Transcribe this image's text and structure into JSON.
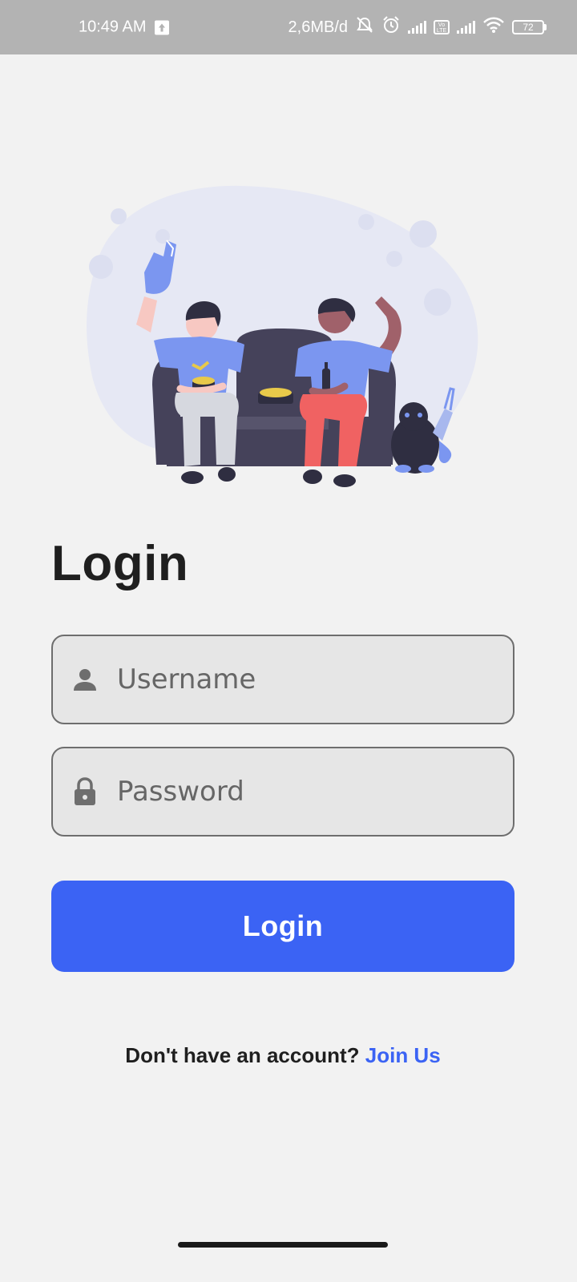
{
  "status_bar": {
    "time": "10:49 AM",
    "data_rate": "2,6MB/d",
    "battery_level": "72",
    "volte_label": "Vo LTE",
    "icons": [
      "upload-icon",
      "mute-icon",
      "alarm-icon",
      "signal-icon",
      "volte-icon",
      "signal-icon",
      "wifi-icon",
      "battery-icon"
    ]
  },
  "illustration": {
    "description_icon": "two-people-on-couch-illustration",
    "colors": {
      "blob": "#e6e8f4",
      "couch": "#45425a",
      "shirt": "#7b96f0",
      "pants_left": "#d6d8df",
      "pants_right": "#f06262",
      "skin_light": "#f7c8c2",
      "skin_dark": "#a0616a",
      "hair": "#2f2e41",
      "snack": "#e8c94a"
    }
  },
  "page": {
    "title": "Login"
  },
  "form": {
    "username": {
      "placeholder": "Username",
      "value": "",
      "icon": "person-icon"
    },
    "password": {
      "placeholder": "Password",
      "value": "",
      "icon": "lock-icon"
    },
    "submit_label": "Login"
  },
  "signup": {
    "prompt": "Don't have an account?",
    "link_label": "Join Us"
  },
  "colors": {
    "background": "#f2f2f2",
    "status_bar": "#b3b3b3",
    "accent": "#3b63f4",
    "field_background": "#e6e6e6",
    "field_border": "#6e6e6e",
    "text_primary": "#1f1f1f",
    "placeholder": "#666666"
  }
}
